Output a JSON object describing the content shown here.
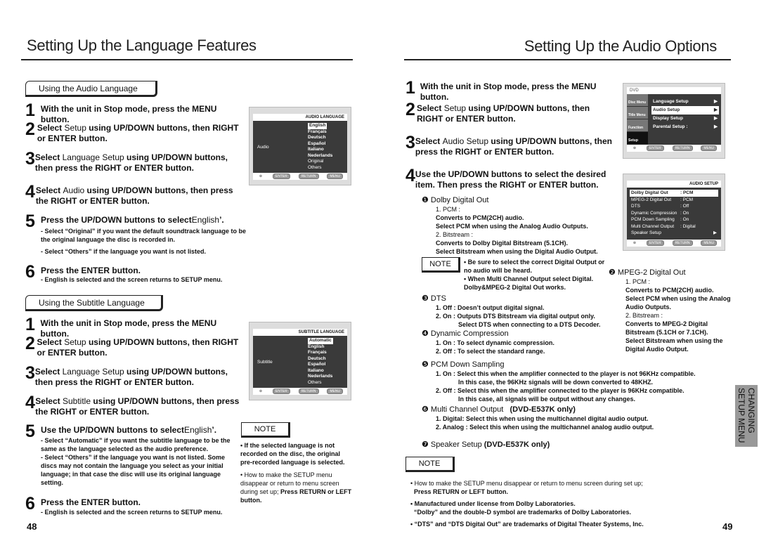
{
  "left": {
    "title": "Setting Up the Language Features",
    "audio_section": "Using the Audio Language",
    "audio_steps": [
      {
        "n": "1",
        "t": "With the unit in Stop mode, press the MENU button."
      },
      {
        "n": "2",
        "a": "Select ",
        "b": "Setup",
        "c": " using UP/DOWN buttons, then RIGHT or ENTER button."
      },
      {
        "n": "3",
        "a": "Select ",
        "b": "Language Setup",
        "c": " using UP/DOWN buttons, then press the RIGHT or ENTER button."
      },
      {
        "n": "4",
        "a": "Select ",
        "b": "Audio",
        "c": " using UP/DOWN buttons, then press the RIGHT or ENTER button."
      },
      {
        "n": "5",
        "a": "Press the UP/DOWN buttons to select",
        "b": "English",
        "c": "’."
      },
      {
        "n": "6",
        "t": "Press the ENTER button."
      }
    ],
    "audio_notes5": [
      "- Select “Original” if you want the default soundtrack language to be the original language the disc is recorded in.",
      "- Select “Others” if the language you want is not listed."
    ],
    "audio_note6": "- English is selected and the screen returns to SETUP menu.",
    "audio_menu": {
      "header": "AUDIO LANGUAGE",
      "label": "Audio",
      "options": [
        "English",
        "Français",
        "Deutsch",
        "Español",
        "Italiano",
        "Nederlands",
        "Original",
        "Others"
      ],
      "footer": [
        "ENTER",
        "RETURN",
        "MENU"
      ]
    },
    "subtitle_section": "Using the Subtitle Language",
    "subtitle_steps": [
      {
        "n": "1",
        "t": "With the unit in Stop mode, press the MENU button."
      },
      {
        "n": "2",
        "a": "Select ",
        "b": "Setup",
        "c": " using UP/DOWN buttons, then RIGHT or ENTER button."
      },
      {
        "n": "3",
        "a": "Select ",
        "b": "Language Setup",
        "c": " using UP/DOWN buttons, then press the RIGHT or ENTER button."
      },
      {
        "n": "4",
        "a": "Select ",
        "b": "Subtitle",
        "c": " using UP/DOWN buttons, then press the RIGHT or ENTER button."
      },
      {
        "n": "5",
        "a": "Use the UP/DOWN buttons to select",
        "b": "English",
        "c": "’."
      },
      {
        "n": "6",
        "t": "Press the ENTER button."
      }
    ],
    "subtitle_notes5": [
      "- Select “Automatic” if you want the subtitle language to be the same as the language selected as the audio preference.",
      "- Select “Others” if the language you want is not listed. Some discs may not contain the language you  select as your initial language; in that case the disc will use its original language setting."
    ],
    "subtitle_note6": "- English is selected and the screen returns to SETUP menu.",
    "subtitle_menu": {
      "header": "SUBTITLE LANGUAGE",
      "label": "Subtitle",
      "options": [
        "Automatic",
        "English",
        "Français",
        "Deutsch",
        "Español",
        "Italiano",
        "Nederlands",
        "Others"
      ],
      "footer": [
        "ENTER",
        "RETURN",
        "MENU"
      ]
    },
    "note_label": "NOTE",
    "note1": "• If the selected language is not recorded on the disc, the original pre-recorded language is selected.",
    "note2a": "• How to make the SETUP menu disappear or  return to menu screen during set up;  ",
    "note2b": "Press RETURN or LEFT button.",
    "page": "48"
  },
  "right": {
    "title": "Setting Up the Audio Options",
    "steps": [
      {
        "n": "1",
        "t": "With the unit in Stop mode, press the MENU button."
      },
      {
        "n": "2",
        "a": "Select ",
        "b": "Setup",
        "c": " using UP/DOWN buttons, then RIGHT or ENTER button."
      },
      {
        "n": "3",
        "a": "Select ",
        "b": "Audio Setup",
        "c": " using UP/DOWN buttons, then press the RIGHT or ENTER button."
      },
      {
        "n": "4",
        "t": "Use the UP/DOWN buttons to select the desired item. Then press the RIGHT or ENTER button."
      }
    ],
    "menu1": {
      "brand": "DVD",
      "side": [
        "Disc Menu",
        "Title Menu",
        "Function",
        "Setup"
      ],
      "items": [
        "Language Setup",
        "Audio Setup",
        "Display Setup",
        "Parental Setup :"
      ],
      "footer": [
        "ENTER",
        "RETURN",
        "MENU"
      ]
    },
    "menu2": {
      "header": "AUDIO SETUP",
      "rows": [
        [
          "Dolby Digital Out",
          ": PCM"
        ],
        [
          "MPEG-2 Digital Out",
          ": PCM"
        ],
        [
          "DTS",
          ": Off"
        ],
        [
          "Dynamic Compression",
          ": On"
        ],
        [
          "PCM Down Sampling",
          ": On"
        ],
        [
          "Multi Channel Output",
          ": Digital"
        ],
        [
          "Speaker Setup",
          ""
        ]
      ],
      "footer": [
        "ENTER",
        "RETURN",
        "MENU"
      ]
    },
    "dolby": {
      "title": "❶ Dolby Digital Out",
      "l1": "1. PCM :",
      "b1": "Converts to PCM(2CH) audio.",
      "b2": "Select PCM when using the Analog Audio Outputs.",
      "l2": "2. Bitstream :",
      "b3": "Converts to Dolby Digital Bitstream (5.1CH).",
      "b4": "Select Bitstream when using the Digital Audio Output."
    },
    "note_label": "NOTE",
    "note_a": [
      "• Be sure to select the correct Digital Output or no audio will be heard.",
      "• When Multi Channel Output select Digital. Dolby&MPEG-2 Digital Out works."
    ],
    "mpeg": {
      "title": "❷ MPEG-2 Digital Out",
      "l1": "1. PCM :",
      "b1": "Converts to PCM(2CH) audio.",
      "b2": "Select PCM when using the Analog Audio Outputs.",
      "l2": "2. Bitstream  :",
      "b3": "Converts to MPEG-2 Digital Bitstream (5.1CH or 7.1CH).",
      "b4": "Select Bitstream when using the Digital Audio Output."
    },
    "dts": {
      "title": "❸ DTS",
      "l1": "1. Off : Doesn’t output digital signal.",
      "l2": "2. On : Outputs DTS Bitstream via digital output only.",
      "l3": "Select DTS when connecting to a DTS Decoder."
    },
    "dyn": {
      "title": "❹ Dynamic Compression",
      "l1": "1. On : To select dynamic compression.",
      "l2": "2. Off : To select the standard range."
    },
    "pcm": {
      "title": "❺ PCM Down Sampling",
      "l1": "1. On : Select this when the amplifier connected to the player is not 96KHz compatible.",
      "l1b": "In this case, the 96KHz signals will be down converted to 48KHZ.",
      "l2": "2. Off : Select this when the amplifier connected to the player is 96KHz compatible.",
      "l2b": "In this case, all signals will be output without any changes."
    },
    "multi": {
      "title": "❻ Multi Channel Output",
      "model": "(DVD-E537K only)",
      "l1": "1. Digital: Select this when using the multichannel digital audio output.",
      "l2": "2. Analog  : Select this when using the multichannel analog audio output."
    },
    "speaker": {
      "title": "❼ Speaker Setup",
      "model": "(DVD-E537K only)"
    },
    "notes": [
      {
        "a": "• How to make the SETUP menu disappear or return to menu screen during set up;",
        "b": "Press RETURN or LEFT button."
      },
      {
        "a": "• Manufactured under license from Dolby Laboratories.",
        "b": "“Dolby” and the double-D symbol are trademarks of Dolby Laboratories."
      },
      {
        "a": "• “DTS” and “DTS Digital Out” are trademarks of Digital Theater Systems, Inc.",
        "b": ""
      }
    ],
    "side_tab": "CHANGING SETUP MENU",
    "page": "49"
  }
}
